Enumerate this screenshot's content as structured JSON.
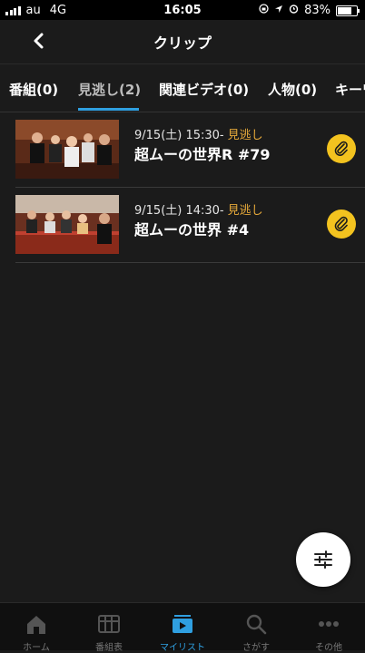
{
  "status_bar": {
    "carrier": "au",
    "network": "4G",
    "time": "16:05",
    "battery_percent": "83%",
    "battery_level": 0.83
  },
  "header": {
    "title": "クリップ"
  },
  "tabs": [
    {
      "label": "番組(0)"
    },
    {
      "label": "見逃し(2)",
      "active": true
    },
    {
      "label": "関連ビデオ(0)"
    },
    {
      "label": "人物(0)"
    },
    {
      "label": "キーワ"
    }
  ],
  "clips": [
    {
      "datetime": "9/15(土) 15:30-",
      "tag": "見逃し",
      "title": "超ムーの世界R #79",
      "icon": "paperclip-icon"
    },
    {
      "datetime": "9/15(土) 14:30-",
      "tag": "見逃し",
      "title": "超ムーの世界 #4",
      "icon": "paperclip-icon"
    }
  ],
  "fab": {
    "icon": "filter-sliders-icon"
  },
  "bottom_nav": [
    {
      "label": "ホーム",
      "icon": "home-icon"
    },
    {
      "label": "番組表",
      "icon": "grid-icon"
    },
    {
      "label": "マイリスト",
      "icon": "play-icon",
      "active": true
    },
    {
      "label": "さがす",
      "icon": "search-icon"
    },
    {
      "label": "その他",
      "icon": "more-icon"
    }
  ],
  "colors": {
    "accent": "#2f9fe0",
    "clip_button": "#f3c31f",
    "tag": "#e6a93a"
  }
}
